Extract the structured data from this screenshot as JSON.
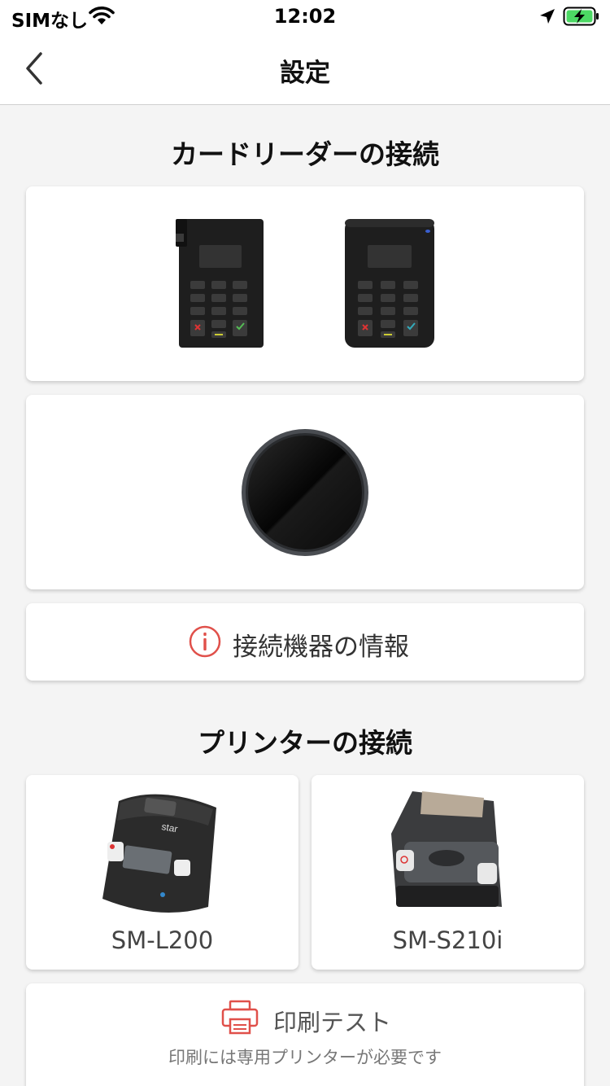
{
  "status_bar": {
    "carrier": "SIMなし",
    "time": "12:02",
    "icons": [
      "wifi-icon",
      "location-arrow-icon",
      "battery-charging-icon"
    ]
  },
  "nav": {
    "title": "設定",
    "back_icon": "chevron-left-icon"
  },
  "card_reader_section": {
    "title": "カードリーダーの接続",
    "readers": [
      "keypad-card-reader",
      "keypad-card-reader-rounded",
      "round-tap-reader"
    ],
    "info_button": {
      "label": "接続機器の情報",
      "icon": "info-circle-icon"
    }
  },
  "printer_section": {
    "title": "プリンターの接続",
    "printers": [
      {
        "label": "SM-L200"
      },
      {
        "label": "SM-S210i"
      }
    ],
    "print_test": {
      "label": "印刷テスト",
      "note": "印刷には専用プリンターが必要です",
      "icon": "printer-icon"
    }
  },
  "colors": {
    "accent": "#e0504a",
    "background": "#f4f4f4",
    "card": "#ffffff"
  }
}
